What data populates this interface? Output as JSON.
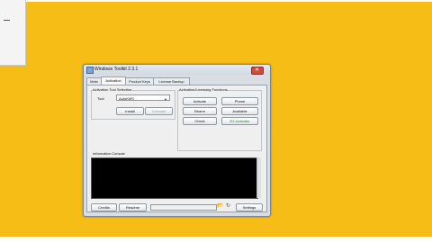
{
  "window": {
    "title": "Windows Toolkit 2.3.1",
    "close_glyph": "✕"
  },
  "tabs": [
    {
      "label": "Main"
    },
    {
      "label": "Activation"
    },
    {
      "label": "Product Keys"
    },
    {
      "label": "License Backup"
    }
  ],
  "activation_tool": {
    "group_title": "Activation Tool Selection",
    "tool_label": "Tool:",
    "tool_value": "AutoKMS",
    "install_label": "Install",
    "uninstall_label": "Uninstall"
  },
  "licensing": {
    "group_title": "Activation/Licensing Functions",
    "activate_label": "Activate",
    "phone_label": "Phone",
    "rearm_label": "Rearm",
    "available_label": "Available",
    "check_label": "Check",
    "ez_activator_label": "EZ-Activator"
  },
  "console": {
    "label": "Information Console"
  },
  "bottom_bar": {
    "credits_label": "Credits",
    "readme_label": "Readme",
    "settings_label": "Settings",
    "progress_fraction": 0.0
  },
  "icons": {
    "folder": "📂",
    "refresh": "↻"
  }
}
